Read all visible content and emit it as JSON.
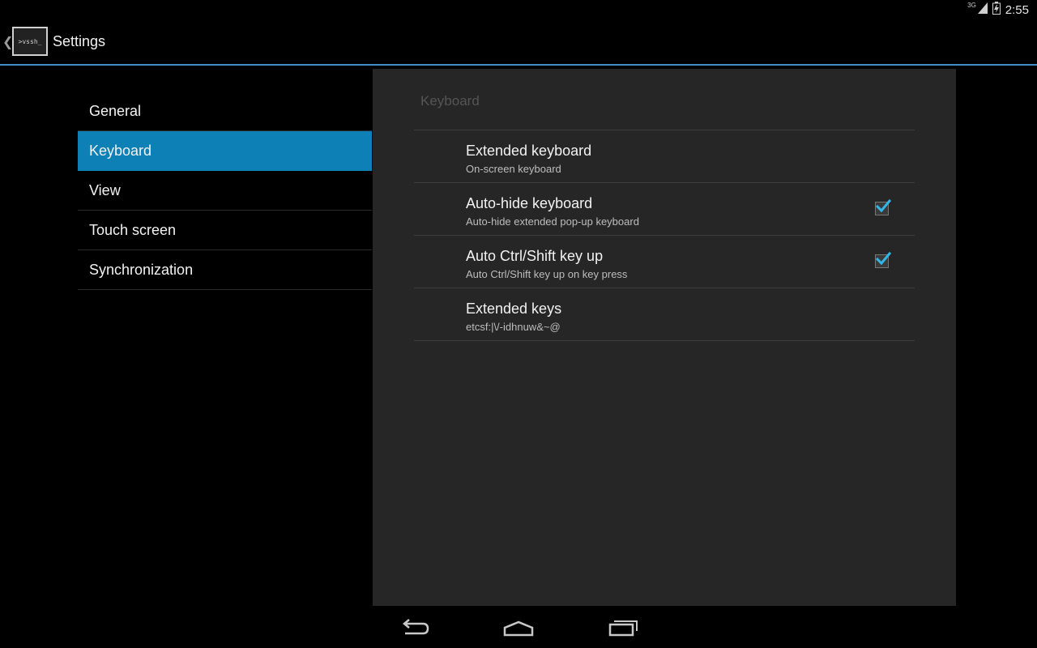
{
  "status_bar": {
    "network_label": "3G",
    "time": "2:55",
    "icons": [
      "signal-icon",
      "battery-icon"
    ]
  },
  "action_bar": {
    "app_icon_text": ">vssh_",
    "title": "Settings",
    "accent_color": "#3e8ec7"
  },
  "headers": {
    "selected": "Keyboard",
    "selected_color": "#0d81b6",
    "items": [
      {
        "label": "General"
      },
      {
        "label": "Keyboard"
      },
      {
        "label": "View"
      },
      {
        "label": "Touch screen"
      },
      {
        "label": "Synchronization"
      }
    ]
  },
  "panel": {
    "title": "Keyboard",
    "prefs": [
      {
        "title": "Extended keyboard",
        "summary": "On-screen keyboard"
      },
      {
        "title": "Auto-hide keyboard",
        "summary": "Auto-hide extended pop-up keyboard",
        "checked": true
      },
      {
        "title": "Auto Ctrl/Shift key up",
        "summary": "Auto Ctrl/Shift key up on key press",
        "checked": true
      },
      {
        "title": "Extended keys",
        "summary": "etcsf:|\\/-idhnuw&~@"
      }
    ]
  },
  "nav_bar": {
    "buttons": [
      "back-icon",
      "home-icon",
      "recents-icon"
    ]
  }
}
